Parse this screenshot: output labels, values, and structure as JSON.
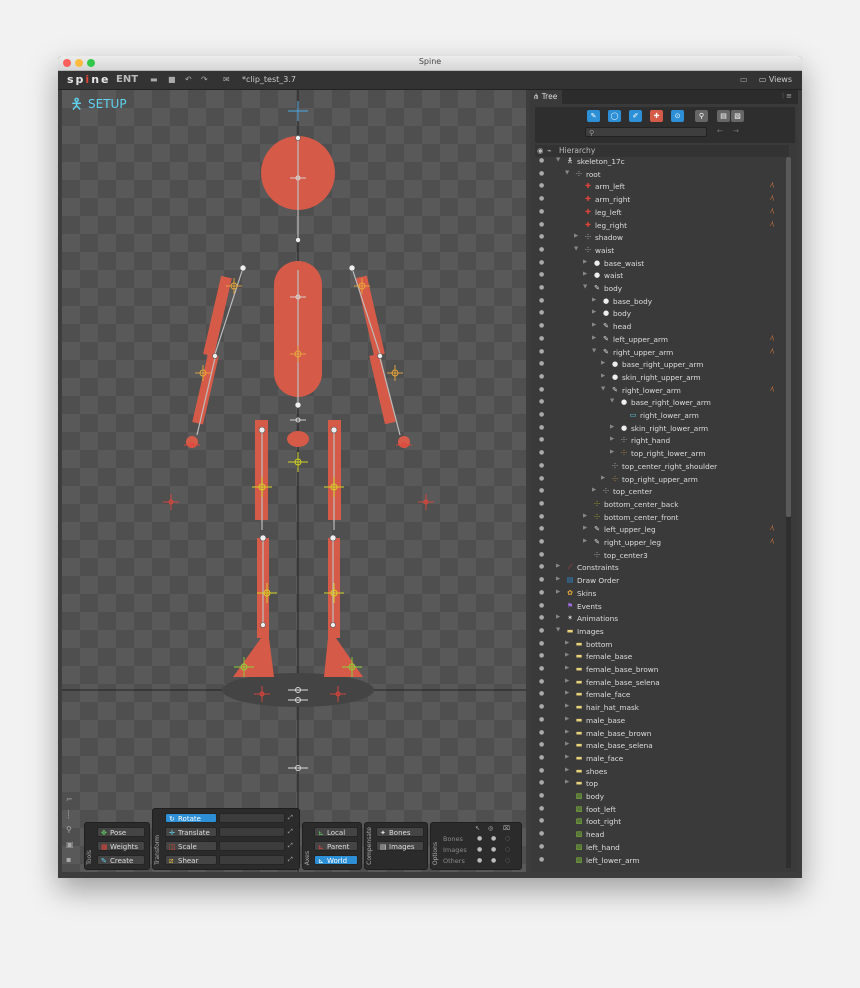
{
  "window": {
    "title": "Spine"
  },
  "toolbar": {
    "logo": "spine",
    "edition": "ENT",
    "file_name": "*clip_test_3.7",
    "views_label": "Views"
  },
  "viewport": {
    "mode_label": "SETUP"
  },
  "tools_panel": {
    "title": "Tools",
    "pose": "Pose",
    "weights": "Weights",
    "create": "Create"
  },
  "transform_panel": {
    "title": "Transform",
    "rotate": "Rotate",
    "translate": "Translate",
    "scale": "Scale",
    "shear": "Shear"
  },
  "axes_panel": {
    "title": "Axes",
    "local": "Local",
    "parent": "Parent",
    "world": "World"
  },
  "compensate_panel": {
    "title": "Compensate",
    "bones": "Bones",
    "images": "Images"
  },
  "options_panel": {
    "title": "Options",
    "rows": [
      "Bones",
      "Images",
      "Others"
    ]
  },
  "tree_panel": {
    "tab_label": "Tree",
    "hierarchy_label": "Hierarchy",
    "search_placeholder": "",
    "nodes": [
      {
        "label": "skeleton_17c",
        "depth": 0,
        "icon": "skeleton",
        "expanded": true
      },
      {
        "label": "root",
        "depth": 1,
        "icon": "bone",
        "expanded": true
      },
      {
        "label": "arm_left",
        "depth": 2,
        "icon": "ik",
        "warn": true
      },
      {
        "label": "arm_right",
        "depth": 2,
        "icon": "ik",
        "warn": true
      },
      {
        "label": "leg_left",
        "depth": 2,
        "icon": "ik",
        "warn": true
      },
      {
        "label": "leg_right",
        "depth": 2,
        "icon": "ik",
        "warn": true
      },
      {
        "label": "shadow",
        "depth": 2,
        "icon": "bone",
        "expandable": true
      },
      {
        "label": "waist",
        "depth": 2,
        "icon": "bone",
        "expanded": true
      },
      {
        "label": "base_waist",
        "depth": 3,
        "icon": "slot",
        "expandable": true
      },
      {
        "label": "waist",
        "depth": 3,
        "icon": "slot",
        "expandable": true
      },
      {
        "label": "body",
        "depth": 3,
        "icon": "bone-pen",
        "expanded": true
      },
      {
        "label": "base_body",
        "depth": 4,
        "icon": "slot",
        "expandable": true
      },
      {
        "label": "body",
        "depth": 4,
        "icon": "slot",
        "expandable": true
      },
      {
        "label": "head",
        "depth": 4,
        "icon": "bone-pen",
        "expandable": true
      },
      {
        "label": "left_upper_arm",
        "depth": 4,
        "icon": "bone-pen",
        "expandable": true,
        "warn": true
      },
      {
        "label": "right_upper_arm",
        "depth": 4,
        "icon": "bone-pen",
        "expanded": true,
        "warn": true
      },
      {
        "label": "base_right_upper_arm",
        "depth": 5,
        "icon": "slot",
        "expandable": true
      },
      {
        "label": "skin_right_upper_arm",
        "depth": 5,
        "icon": "slot",
        "expandable": true
      },
      {
        "label": "right_lower_arm",
        "depth": 5,
        "icon": "bone-pen",
        "expanded": true,
        "warn": true
      },
      {
        "label": "base_right_lower_arm",
        "depth": 6,
        "icon": "slot",
        "expanded": true
      },
      {
        "label": "right_lower_arm",
        "depth": 7,
        "icon": "mesh"
      },
      {
        "label": "skin_right_lower_arm",
        "depth": 6,
        "icon": "slot",
        "expandable": true
      },
      {
        "label": "right_hand",
        "depth": 6,
        "icon": "bone",
        "expandable": true
      },
      {
        "label": "top_right_lower_arm",
        "depth": 6,
        "icon": "bone-orange",
        "expandable": true
      },
      {
        "label": "top_center_right_shoulder",
        "depth": 5,
        "icon": "bone"
      },
      {
        "label": "top_right_upper_arm",
        "depth": 5,
        "icon": "bone-orange",
        "expandable": true
      },
      {
        "label": "top_center",
        "depth": 4,
        "icon": "bone",
        "expandable": true
      },
      {
        "label": "bottom_center_back",
        "depth": 3,
        "icon": "bone-yellow"
      },
      {
        "label": "bottom_center_front",
        "depth": 3,
        "icon": "bone-yellow",
        "expandable": true
      },
      {
        "label": "left_upper_leg",
        "depth": 3,
        "icon": "bone-pen",
        "expandable": true,
        "warn": true
      },
      {
        "label": "right_upper_leg",
        "depth": 3,
        "icon": "bone-pen",
        "expandable": true,
        "warn": true
      },
      {
        "label": "top_center3",
        "depth": 3,
        "icon": "bone"
      },
      {
        "label": "Constraints",
        "depth": 0,
        "icon": "constraints",
        "expandable": true
      },
      {
        "label": "Draw Order",
        "depth": 0,
        "icon": "draw-order",
        "expandable": true
      },
      {
        "label": "Skins",
        "depth": 0,
        "icon": "skins",
        "expandable": true
      },
      {
        "label": "Events",
        "depth": 0,
        "icon": "events"
      },
      {
        "label": "Animations",
        "depth": 0,
        "icon": "animations",
        "expandable": true
      },
      {
        "label": "Images",
        "depth": 0,
        "icon": "folder",
        "expanded": true
      },
      {
        "label": "bottom",
        "depth": 1,
        "icon": "folder",
        "expandable": true
      },
      {
        "label": "female_base",
        "depth": 1,
        "icon": "folder",
        "expandable": true
      },
      {
        "label": "female_base_brown",
        "depth": 1,
        "icon": "folder",
        "expandable": true
      },
      {
        "label": "female_base_selena",
        "depth": 1,
        "icon": "folder",
        "expandable": true
      },
      {
        "label": "female_face",
        "depth": 1,
        "icon": "folder",
        "expandable": true
      },
      {
        "label": "hair_hat_mask",
        "depth": 1,
        "icon": "folder",
        "expandable": true
      },
      {
        "label": "male_base",
        "depth": 1,
        "icon": "folder",
        "expandable": true
      },
      {
        "label": "male_base_brown",
        "depth": 1,
        "icon": "folder",
        "expandable": true
      },
      {
        "label": "male_base_selena",
        "depth": 1,
        "icon": "folder",
        "expandable": true
      },
      {
        "label": "male_face",
        "depth": 1,
        "icon": "folder",
        "expandable": true
      },
      {
        "label": "shoes",
        "depth": 1,
        "icon": "folder",
        "expandable": true
      },
      {
        "label": "top",
        "depth": 1,
        "icon": "folder",
        "expandable": true
      },
      {
        "label": "body",
        "depth": 1,
        "icon": "image"
      },
      {
        "label": "foot_left",
        "depth": 1,
        "icon": "image"
      },
      {
        "label": "foot_right",
        "depth": 1,
        "icon": "image"
      },
      {
        "label": "head",
        "depth": 1,
        "icon": "image"
      },
      {
        "label": "left_hand",
        "depth": 1,
        "icon": "image"
      },
      {
        "label": "left_lower_arm",
        "depth": 1,
        "icon": "image"
      }
    ]
  },
  "colors": {
    "accent": "#2d8fd6",
    "setup": "#5fd3ef",
    "attachment": "#d65a48",
    "warning": "#e07a3a"
  }
}
